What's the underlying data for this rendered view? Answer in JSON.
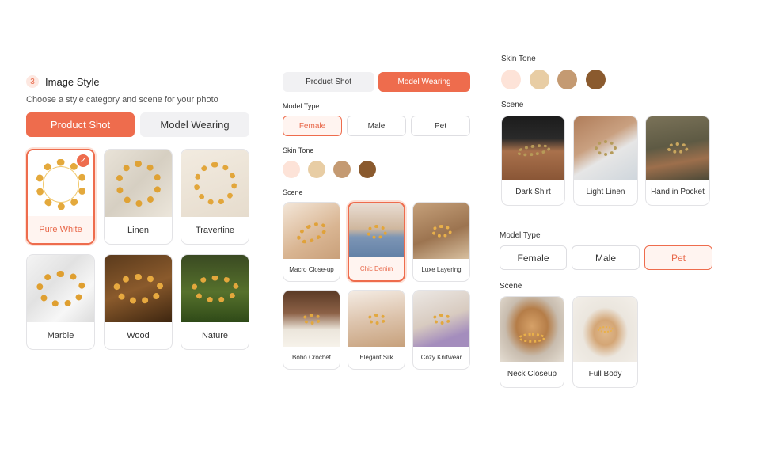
{
  "panel1": {
    "step_number": "3",
    "title": "Image Style",
    "subtitle": "Choose a style category and scene for your photo",
    "tabs": [
      "Product Shot",
      "Model Wearing"
    ],
    "active_tab": "Product Shot",
    "cards": [
      {
        "label": "Pure White",
        "selected": true
      },
      {
        "label": "Linen",
        "selected": false
      },
      {
        "label": "Travertine",
        "selected": false
      },
      {
        "label": "Marble",
        "selected": false
      },
      {
        "label": "Wood",
        "selected": false
      },
      {
        "label": "Nature",
        "selected": false
      }
    ]
  },
  "panel2": {
    "tabs": [
      "Product Shot",
      "Model Wearing"
    ],
    "active_tab": "Model Wearing",
    "model_type_label": "Model Type",
    "model_types": [
      "Female",
      "Male",
      "Pet"
    ],
    "active_model_type": "Female",
    "skin_tone_label": "Skin Tone",
    "scene_label": "Scene",
    "scenes": [
      {
        "label": "Macro Close-up",
        "selected": false
      },
      {
        "label": "Chic Denim",
        "selected": true
      },
      {
        "label": "Luxe Layering",
        "selected": false
      },
      {
        "label": "Boho Crochet",
        "selected": false
      },
      {
        "label": "Elegant Silk",
        "selected": false
      },
      {
        "label": "Cozy Knitwear",
        "selected": false
      }
    ]
  },
  "panel3": {
    "skin_tone_label": "Skin Tone",
    "scene_label": "Scene",
    "scenes": [
      "Dark Shirt",
      "Light Linen",
      "Hand in Pocket"
    ]
  },
  "panel4": {
    "model_type_label": "Model Type",
    "model_types": [
      "Female",
      "Male",
      "Pet"
    ],
    "active_model_type": "Pet",
    "scene_label": "Scene",
    "scenes": [
      "Neck Closeup",
      "Full Body"
    ]
  },
  "skin_tones": [
    "#fde3d8",
    "#e8cda4",
    "#c49a72",
    "#8a5a2e"
  ],
  "colors": {
    "accent": "#ee6c4d",
    "accent_light": "#fff4f0"
  }
}
